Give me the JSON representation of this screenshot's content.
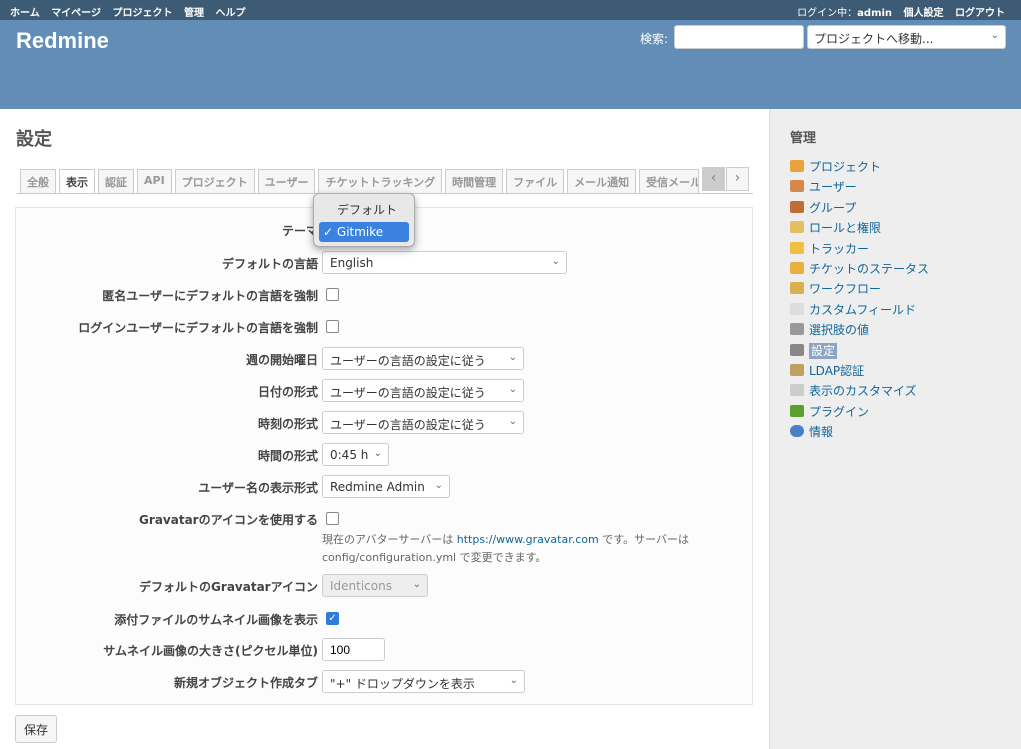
{
  "top_menu": {
    "left": [
      "ホーム",
      "マイページ",
      "プロジェクト",
      "管理",
      "ヘルプ"
    ],
    "login_prefix": "ログイン中：",
    "user": "admin",
    "my_account": "個人設定",
    "logout": "ログアウト"
  },
  "header": {
    "title": "Redmine",
    "search_label": "検索:",
    "search_value": "",
    "project_jump": "プロジェクトへ移動..."
  },
  "content": {
    "title": "設定",
    "tabs": [
      "全般",
      "表示",
      "認証",
      "API",
      "プロジェクト",
      "ユーザー",
      "チケットトラッキング",
      "時間管理",
      "ファイル",
      "メール通知",
      "受信メール"
    ],
    "selected_tab": "表示"
  },
  "form": {
    "theme": {
      "label": "テーマ"
    },
    "default_language": {
      "label": "デフォルトの言語",
      "value": "English"
    },
    "force_default_anon": {
      "label": "匿名ユーザーにデフォルトの言語を強制",
      "checked": false
    },
    "force_default_login": {
      "label": "ログインユーザーにデフォルトの言語を強制",
      "checked": false
    },
    "start_of_week": {
      "label": "週の開始曜日",
      "value": "ユーザーの言語の設定に従う"
    },
    "date_format": {
      "label": "日付の形式",
      "value": "ユーザーの言語の設定に従う"
    },
    "time_format": {
      "label": "時刻の形式",
      "value": "ユーザーの言語の設定に従う"
    },
    "timespan_format": {
      "label": "時間の形式",
      "value": "0:45 h"
    },
    "user_format": {
      "label": "ユーザー名の表示形式",
      "value": "Redmine Admin"
    },
    "gravatar": {
      "label": "Gravatarのアイコンを使用する",
      "checked": false,
      "hint_1": "現在のアバターサーバーは",
      "hint_link": "https://www.gravatar.com",
      "hint_2": "です。サーバーは",
      "hint_3": "config/configuration.yml で変更できます。"
    },
    "gravatar_default": {
      "label": "デフォルトのGravatarアイコン",
      "value": "Identicons"
    },
    "thumbnails": {
      "label": "添付ファイルのサムネイル画像を表示",
      "checked": true
    },
    "thumbnail_size": {
      "label": "サムネイル画像の大きさ(ピクセル単位)",
      "value": "100"
    },
    "new_item_menu": {
      "label": "新規オブジェクト作成タブ",
      "value": "\"+\" ドロップダウンを表示"
    },
    "save": "保存"
  },
  "theme_dropdown": {
    "options": [
      "デフォルト",
      "Gitmike"
    ],
    "selected": "Gitmike",
    "check": "✓"
  },
  "sidebar": {
    "title": "管理",
    "items": [
      {
        "label": "プロジェクト",
        "color": "#e8a33d"
      },
      {
        "label": "ユーザー",
        "color": "#d4884a"
      },
      {
        "label": "グループ",
        "color": "#c06d3a"
      },
      {
        "label": "ロールと権限",
        "color": "#e0c060"
      },
      {
        "label": "トラッカー",
        "color": "#f0c040"
      },
      {
        "label": "チケットのステータス",
        "color": "#e8b040"
      },
      {
        "label": "ワークフロー",
        "color": "#d8b050"
      },
      {
        "label": "カスタムフィールド",
        "color": "#dddddd"
      },
      {
        "label": "選択肢の値",
        "color": "#999999"
      },
      {
        "label": "設定",
        "color": "#888888"
      },
      {
        "label": "LDAP認証",
        "color": "#c0a060"
      },
      {
        "label": "表示のカスタマイズ",
        "color": "#cccccc"
      },
      {
        "label": "プラグイン",
        "color": "#5aa030"
      },
      {
        "label": "情報",
        "color": "#4a80c8"
      }
    ]
  }
}
